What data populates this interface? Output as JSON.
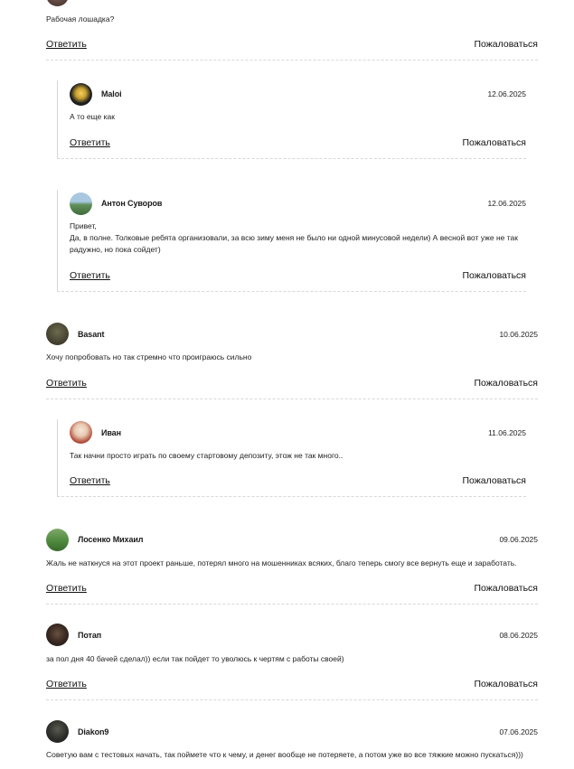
{
  "labels": {
    "reply": "Ответить",
    "report": "Пожаловаться"
  },
  "comments": [
    {
      "text": "Рабочая лошадка?"
    },
    {
      "name": "Maloi",
      "date": "12.06.2025",
      "text": "А то еще как"
    },
    {
      "name": "Антон Суворов",
      "date": "12.06.2025",
      "text": "Привет,\nДа, в полне. Толковые ребята организовали, за всю зиму меня не было ни одной минусовой недели) А весной вот уже не так радужно, но пока сойдет)"
    },
    {
      "name": "Basant",
      "date": "10.06.2025",
      "text": "Хочу попробовать но так стремно что проиграюсь сильно"
    },
    {
      "name": "Иван",
      "date": "11.06.2025",
      "text": "Так начни просто играть по своему стартовому депозиту, этож не так много.."
    },
    {
      "name": "Лосенко Михаил",
      "date": "09.06.2025",
      "text": "Жаль не наткнуся на этот проект раньше, потерял много на мошенниках всяких, благо теперь смогу все вернуть еще и заработать."
    },
    {
      "name": "Потап",
      "date": "08.06.2025",
      "text": "за пол дня 40 бачей сделал)) если так пойдет то уволюсь к чертям с работы своей)"
    },
    {
      "name": "Diakon9",
      "date": "07.06.2025",
      "text": "Советую вам с тестовых начать, так поймете что к чему, и денег вообще не потеряете, а потом уже во все тяжкие можно пускаться)))"
    }
  ]
}
